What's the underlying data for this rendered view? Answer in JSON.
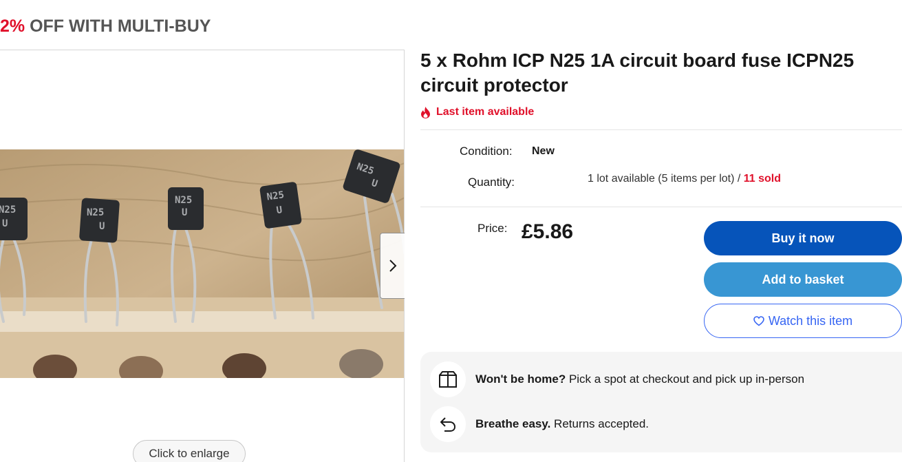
{
  "promo": {
    "percent": "2%",
    "text": "OFF WITH MULTI-BUY"
  },
  "gallery": {
    "photo_labels": [
      "N25",
      "U"
    ],
    "next_icon": "chevron-right-icon",
    "enlarge_label": "Click to enlarge"
  },
  "item": {
    "title": "5 x Rohm ICP N25 1A circuit board fuse ICPN25 circuit protector",
    "urgency": "Last item available",
    "urgency_icon": "flame-icon",
    "condition_label": "Condition:",
    "condition_value": "New",
    "quantity_label": "Quantity:",
    "quantity_available": "1 lot available (5 items per lot) / ",
    "quantity_sold": "11 sold",
    "price_label": "Price:",
    "price": "£5.86"
  },
  "actions": {
    "buy_now": "Buy it now",
    "add_to_basket": "Add to basket",
    "watch": "Watch this item",
    "watch_icon": "heart-icon"
  },
  "info": {
    "pickup_bold": "Won't be home?",
    "pickup_text": " Pick a spot at checkout and pick up in-person",
    "pickup_icon": "package-icon",
    "returns_bold": "Breathe easy.",
    "returns_text": " Returns accepted.",
    "returns_icon": "return-arrow-icon"
  },
  "colors": {
    "accent_red": "#e0102a",
    "buy_now_bg": "#0654ba",
    "basket_bg": "#3896d3",
    "watch_border": "#3665f3"
  }
}
